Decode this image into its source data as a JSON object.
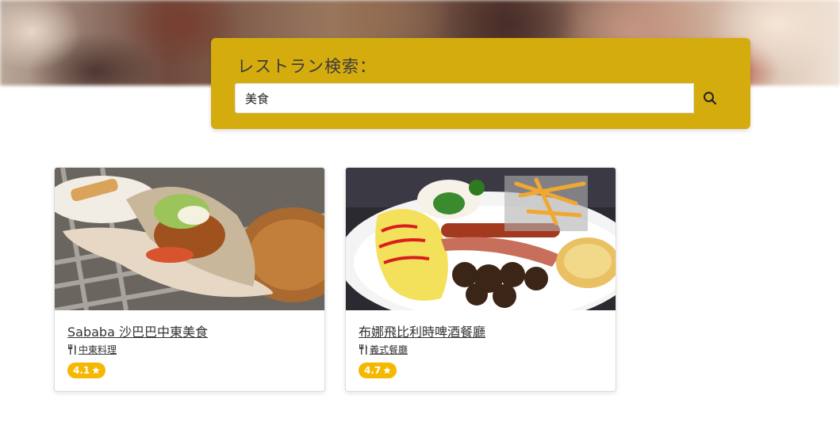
{
  "search": {
    "title": "レストラン検索：",
    "value": "美食",
    "icon": "search-icon"
  },
  "restaurants": [
    {
      "name": "Sababa 沙巴巴中東美食",
      "category": "中東料理",
      "rating": "4.1",
      "image": "pita-wrap-photo"
    },
    {
      "name": "布娜飛比利時啤酒餐廳",
      "category": "義式餐廳",
      "rating": "4.7",
      "image": "sausage-platter-photo"
    }
  ],
  "colors": {
    "panel": "#d4ac0d",
    "badge": "#f5b800"
  }
}
